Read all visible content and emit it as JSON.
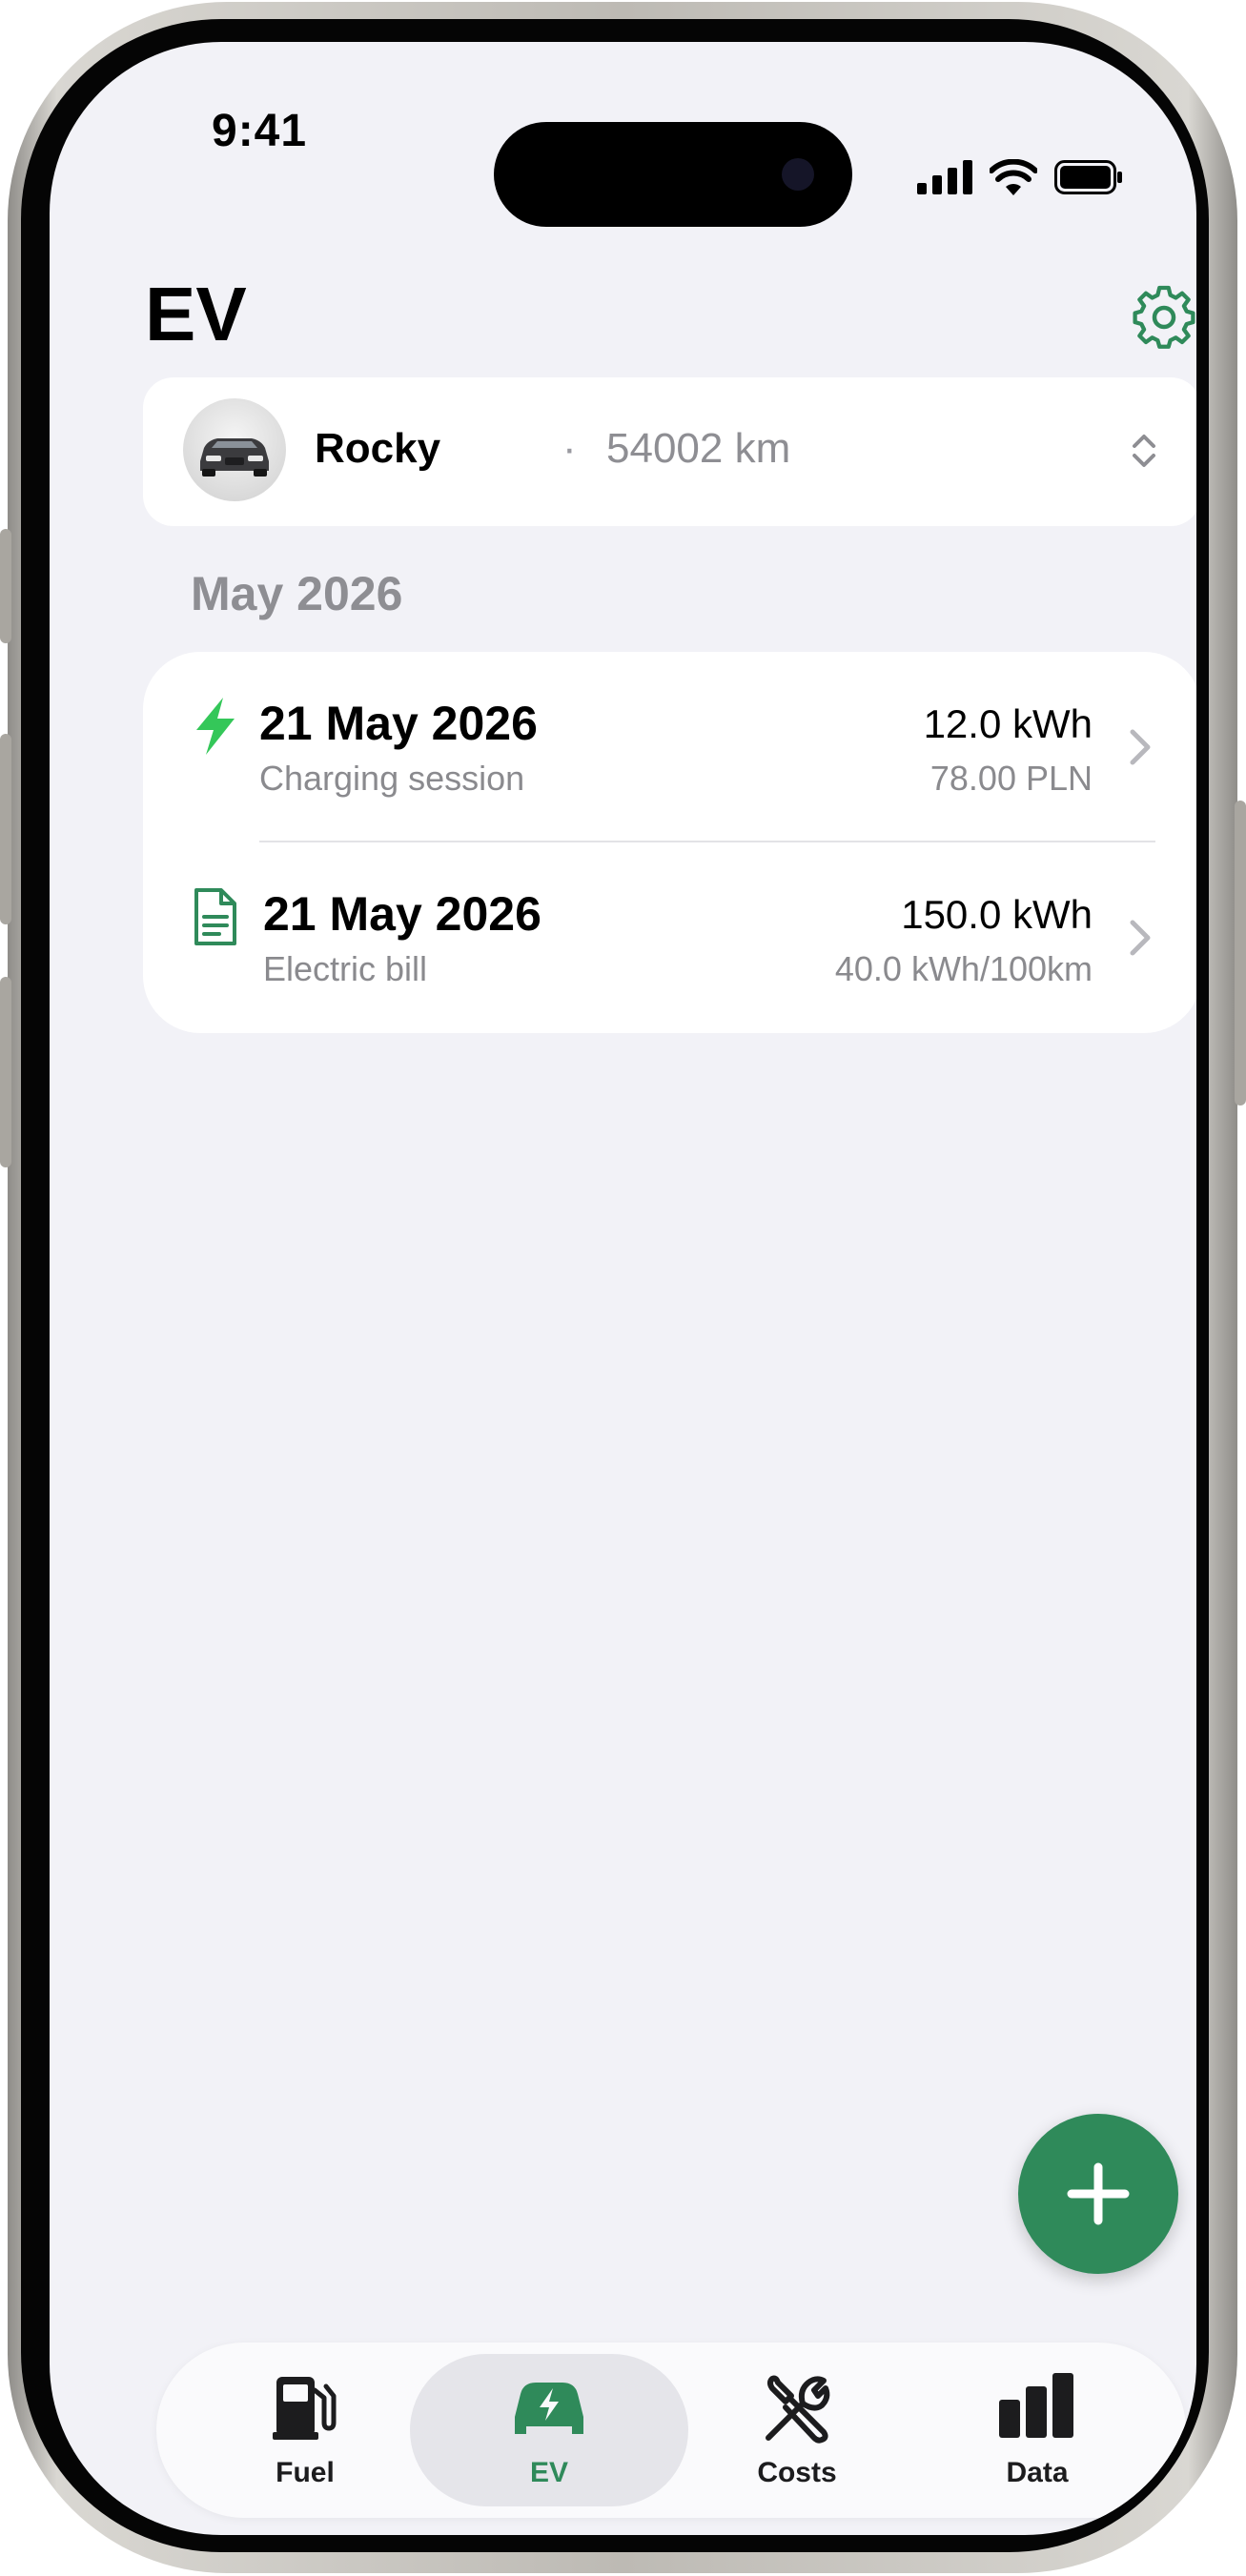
{
  "status_bar": {
    "time": "9:41"
  },
  "header": {
    "title": "EV"
  },
  "vehicle": {
    "name": "Rocky",
    "separator": "·",
    "odometer": "54002 km"
  },
  "section": {
    "title": "May 2026"
  },
  "entries": [
    {
      "icon": "lightning-bolt-icon",
      "date": "21 May 2026",
      "type": "Charging session",
      "value": "12.0 kWh",
      "secondary": "78.00 PLN"
    },
    {
      "icon": "document-icon",
      "date": "21 May 2026",
      "type": "Electric bill",
      "value": "150.0 kWh",
      "secondary": "40.0 kWh/100km"
    }
  ],
  "tabs": [
    {
      "label": "Fuel",
      "icon": "fuel-pump-icon",
      "active": false
    },
    {
      "label": "EV",
      "icon": "ev-car-icon",
      "active": true
    },
    {
      "label": "Costs",
      "icon": "tools-icon",
      "active": false
    },
    {
      "label": "Data",
      "icon": "bar-chart-icon",
      "active": false
    }
  ],
  "colors": {
    "accent": "#2f8a5a",
    "bolt": "#34c759",
    "background": "#f2f2f7"
  }
}
